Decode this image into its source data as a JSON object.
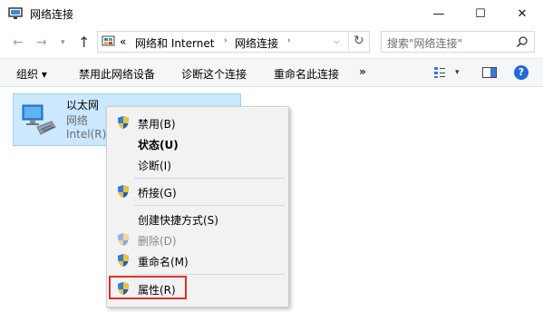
{
  "window": {
    "title": "网络连接",
    "minimize_glyph": "—",
    "maximize_glyph": "☐",
    "close_glyph": "✕"
  },
  "nav": {
    "back_glyph": "←",
    "forward_glyph": "→",
    "recent_glyph": "▾",
    "up_glyph": "↑",
    "address_prefix": "«",
    "breadcrumbs": [
      "网络和 Internet",
      "网络连接"
    ],
    "separator_glyph": "›",
    "dropdown_glyph": "⌵",
    "refresh_glyph": "↻",
    "search_placeholder": "搜索\"网络连接\""
  },
  "commandbar": {
    "items": [
      "组织 ▾",
      "禁用此网络设备",
      "诊断这个连接",
      "重命名此连接"
    ],
    "more_glyph": "»",
    "view_drop_glyph": "▾",
    "help_glyph": "?"
  },
  "connection": {
    "name": "以太网",
    "status": "网络",
    "device": "Intel(R)"
  },
  "context_menu": {
    "items": [
      {
        "label": "禁用(B)",
        "shield": true
      },
      {
        "label": "状态(U)",
        "bold": true
      },
      {
        "label": "诊断(I)"
      },
      {
        "label": "桥接(G)",
        "shield": true
      },
      {
        "label": "创建快捷方式(S)"
      },
      {
        "label": "删除(D)",
        "shield": true,
        "disabled": true
      },
      {
        "label": "重命名(M)",
        "shield": true
      },
      {
        "label": "属性(R)",
        "shield": true
      }
    ],
    "highlight_color": "#e0302a"
  },
  "colors": {
    "selection_fill": "#cce8ff",
    "selection_border": "#99d1ff",
    "menu_bg": "#f2f2f2",
    "help_blue": "#1e6bd6"
  }
}
